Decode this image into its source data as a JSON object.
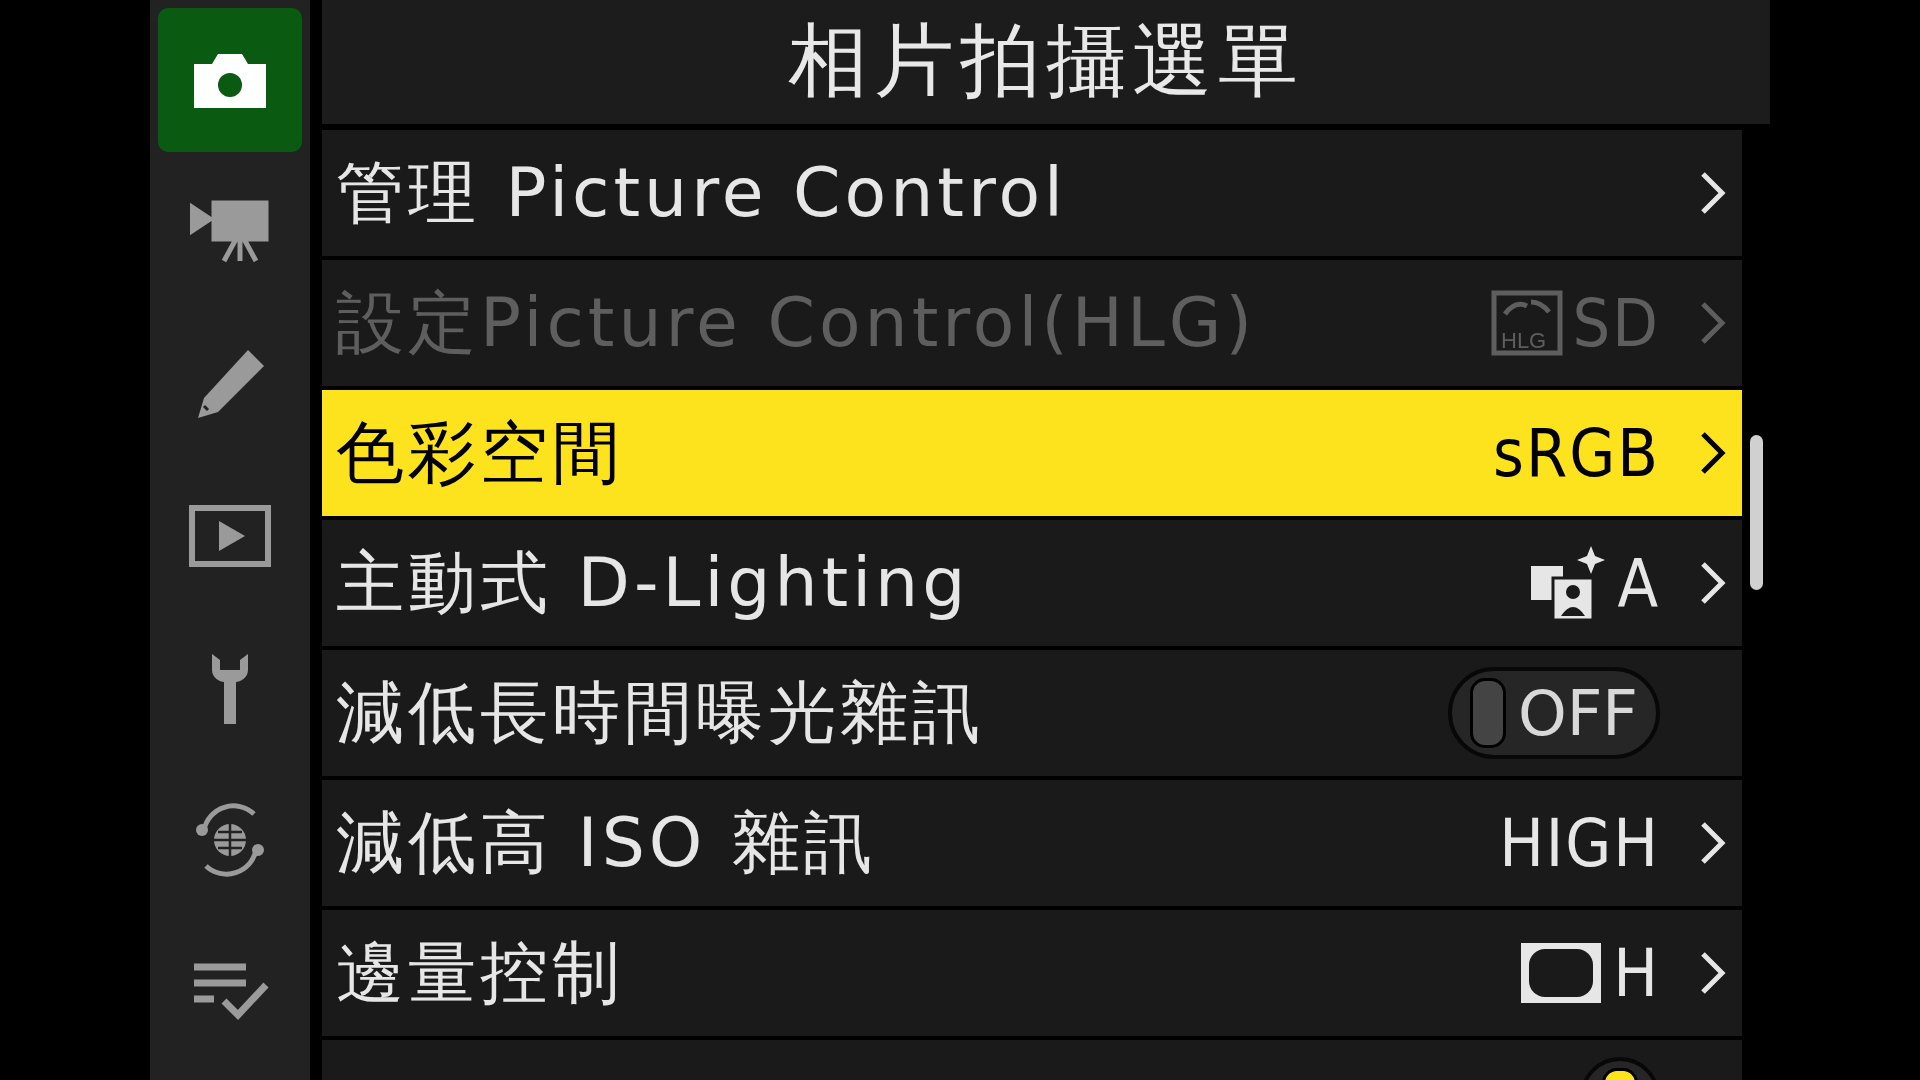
{
  "sidebar": {
    "items": [
      {
        "kind": "photo",
        "selected": true
      },
      {
        "kind": "movie",
        "selected": false
      },
      {
        "kind": "retouch",
        "selected": false
      },
      {
        "kind": "playback",
        "selected": false
      },
      {
        "kind": "setup",
        "selected": false
      },
      {
        "kind": "network",
        "selected": false
      },
      {
        "kind": "mymenu",
        "selected": false
      }
    ]
  },
  "title": "相片拍攝選單",
  "rows": [
    {
      "kind": "submenu",
      "label": "管理 Picture Control",
      "disabled": false,
      "selected": false
    },
    {
      "kind": "hlg-value",
      "label": "設定Picture Control(HLG)",
      "value": "SD",
      "icon_text": "HLG",
      "disabled": true,
      "selected": false
    },
    {
      "kind": "value",
      "label": "色彩空間",
      "value": "sRGB",
      "disabled": false,
      "selected": true
    },
    {
      "kind": "adl-value",
      "label": "主動式 D-Lighting",
      "value": "A",
      "disabled": false,
      "selected": false
    },
    {
      "kind": "toggle",
      "label": "減低長時間曝光雜訊",
      "value": "OFF",
      "on": false,
      "disabled": false,
      "selected": false
    },
    {
      "kind": "value",
      "label": "減低高 ISO 雜訊",
      "value": "HIGH",
      "disabled": false,
      "selected": false
    },
    {
      "kind": "vignette-value",
      "label": "邊量控制",
      "value": "H",
      "disabled": false,
      "selected": false
    },
    {
      "kind": "toggle",
      "on": true,
      "disabled": false,
      "selected": false
    }
  ]
}
